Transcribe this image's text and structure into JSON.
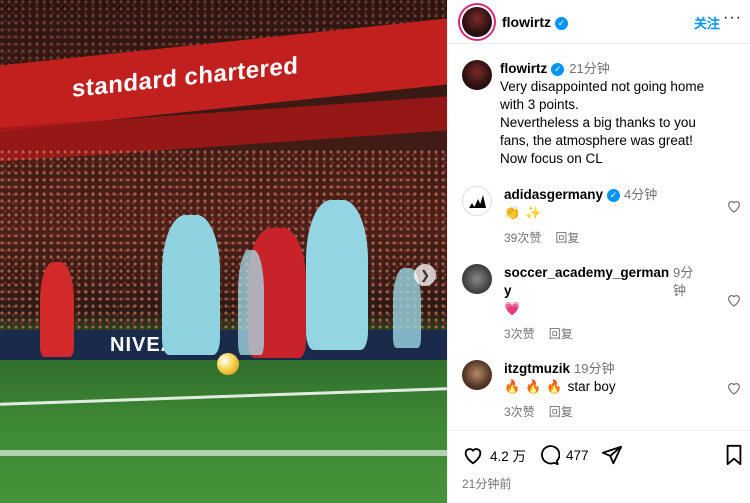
{
  "photo": {
    "board_top": "standard chartered",
    "board_bottom": "NIVEA"
  },
  "header": {
    "username": "flowirtz",
    "follow": "关注",
    "more": "···"
  },
  "caption": {
    "username": "flowirtz",
    "time": "21分钟",
    "text_lines": [
      "Very disappointed not going home",
      "with 3 points.",
      "Nevertheless a big thanks to you",
      "fans, the atmosphere was great!",
      "Now focus on CL"
    ]
  },
  "comments": [
    {
      "username": "adidasgermany",
      "time": "4分钟",
      "emoji": [
        "👏",
        "✨"
      ],
      "likes": "39次赞",
      "reply": "回复"
    },
    {
      "username_line1": "soccer_academy_german",
      "username_line2": "y",
      "time": "9分钟",
      "emoji": [
        "💗"
      ],
      "likes": "3次赞",
      "reply": "回复"
    },
    {
      "username": "itzgtmuzik",
      "time": "19分钟",
      "emoji": [
        "🔥",
        "🔥",
        "🔥"
      ],
      "text": "star boy",
      "likes": "3次赞",
      "reply": "回复"
    }
  ],
  "footer": {
    "likes": "4.2 万",
    "comments": "477",
    "posted": "21分钟前"
  },
  "colors": {
    "accent": "#0095f6",
    "muted": "#737373"
  }
}
